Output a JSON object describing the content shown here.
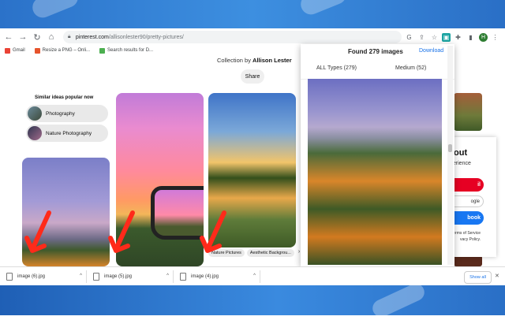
{
  "browser": {
    "url_host": "pinterest.com",
    "url_path": "/allisonlester90/pretty-pictures/",
    "profile_initial": "H"
  },
  "bookmarks": [
    {
      "label": "Gmail",
      "icon": "gmail-icon",
      "color": "#ea4335"
    },
    {
      "label": "Resize a PNG – Onli...",
      "icon": "resize-icon",
      "color": "#e6542c"
    },
    {
      "label": "Search results for D...",
      "icon": "v-icon",
      "color": "#4caf50"
    }
  ],
  "page": {
    "collection_prefix": "Collection by",
    "collection_author": "Allison Lester",
    "share_label": "Share",
    "similar_title": "Similar ideas popular now",
    "similar": [
      {
        "label": "Photography"
      },
      {
        "label": "Nature Photography"
      }
    ],
    "tags": [
      "Nature Pictures",
      "Aesthetic Backgrou..."
    ],
    "tags_next": "›"
  },
  "signup": {
    "title_fragment": "out",
    "subtitle_fragment": "perience",
    "email_fragment": "il",
    "google_fragment": "ogle",
    "facebook_fragment": "book",
    "terms_line1": "erms of Service",
    "terms_line2": "vacy Policy."
  },
  "popup": {
    "found_label": "Found 279 images",
    "download_label": "Download",
    "type_filter": "ALL Types (279)",
    "size_filter": "Medium (52)"
  },
  "downloads": {
    "items": [
      {
        "name": "image (6).jpg"
      },
      {
        "name": "image (5).jpg"
      },
      {
        "name": "image (4).jpg"
      }
    ],
    "show_all": "Show all"
  }
}
